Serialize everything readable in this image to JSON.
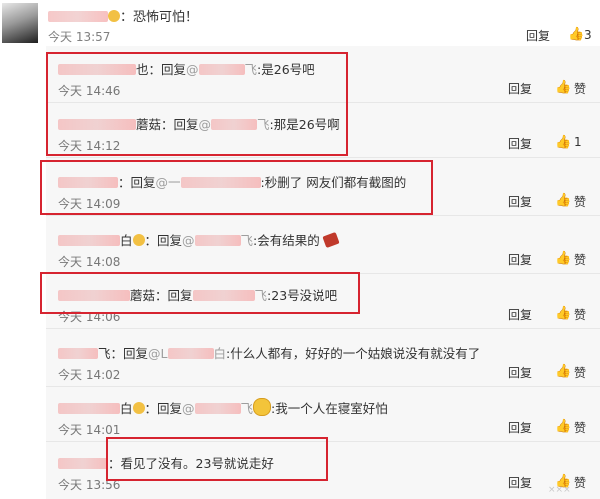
{
  "top_comment": {
    "user": "",
    "text": "：恐怖可怕！",
    "time": "今天 13:57",
    "reply_label": "回复",
    "likes": "3"
  },
  "replies": [
    {
      "name_tail": "也",
      "text_a": "：回复",
      "at_tail": "飞",
      "text_b": ":是26号吧",
      "time": "今天 14:46",
      "reply_label": "回复",
      "like_label": "赞"
    },
    {
      "name_tail": "蘑菇",
      "text_a": "：回复",
      "at_tail": "飞",
      "text_b": ":那是26号啊",
      "time": "今天 14:12",
      "reply_label": "回复",
      "like_label": "1"
    },
    {
      "name_tail": "",
      "text_a": "：回复",
      "at_tail": "",
      "text_b": ":秒删了 网友们都有截图的",
      "time": "今天 14:09",
      "reply_label": "回复",
      "like_label": "赞"
    },
    {
      "name_tail": "白",
      "text_a": "：回复",
      "at_tail": "飞",
      "text_b": ":会有结果的",
      "time": "今天 14:08",
      "reply_label": "回复",
      "like_label": "赞"
    },
    {
      "name_tail": "蘑菇",
      "text_a": "：回复",
      "at_tail": "飞",
      "text_b": ":23号没说吧",
      "time": "今天 14:06",
      "reply_label": "回复",
      "like_label": "赞"
    },
    {
      "name_tail": "飞",
      "text_a": "：回复",
      "at_tail": "白",
      "text_b": ":什么人都有，好好的一个姑娘说没有就没有了",
      "time": "今天 14:02",
      "reply_label": "回复",
      "like_label": "赞"
    },
    {
      "name_tail": "白",
      "text_a": "：回复",
      "at_tail": "飞",
      "text_b": ":我一个人在寝室好怕",
      "time": "今天 14:01",
      "reply_label": "回复",
      "like_label": "赞"
    },
    {
      "name_tail": "",
      "text_a": "：看见了没有。23号就说走好",
      "at_tail": "",
      "text_b": "",
      "time": "今天 13:56",
      "reply_label": "回复",
      "like_label": "赞"
    }
  ],
  "colors": {
    "highlight": "#d62430",
    "sub_bg": "#f7f7f7"
  },
  "watermark": "×××"
}
